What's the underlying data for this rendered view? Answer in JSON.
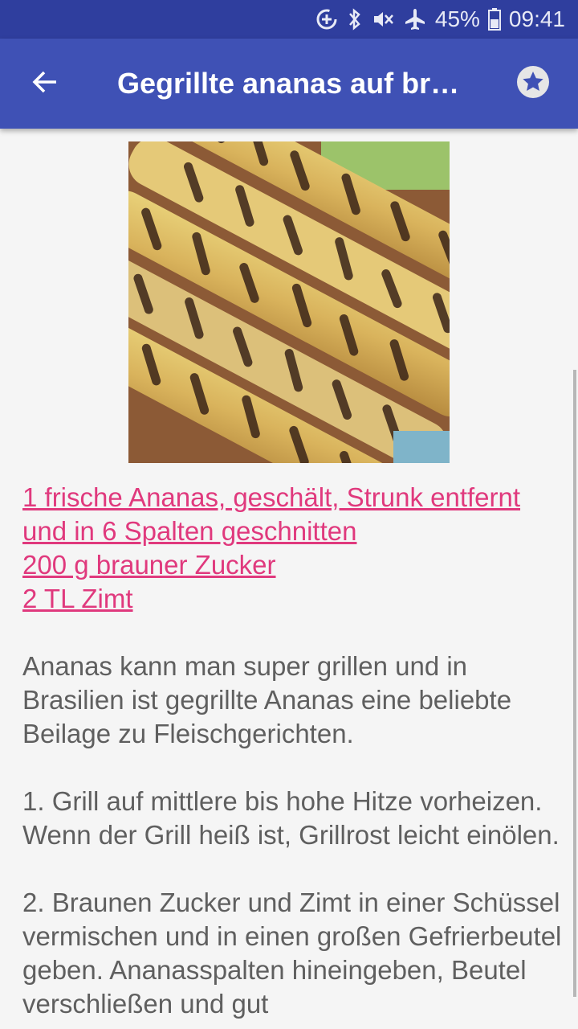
{
  "status_bar": {
    "battery": "45%",
    "time": "09:41",
    "icons": [
      "data-saver-icon",
      "bluetooth-icon",
      "mute-vibrate-icon",
      "airplane-icon",
      "battery-icon"
    ]
  },
  "app_bar": {
    "title": "Gegrillte ananas auf br…",
    "back_icon": "arrow-left-icon",
    "favorite_icon": "star-icon"
  },
  "colors": {
    "status_bar": "#2f3e9e",
    "app_bar": "#3f51b5",
    "link": "#e0397d",
    "body_text": "#5f5f5f",
    "background": "#f5f5f5"
  },
  "recipe": {
    "ingredients": [
      "1 frische Ananas, geschält, Strunk entfernt und in 6 Spalten geschnitten",
      "200 g brauner Zucker",
      "2 TL Zimt"
    ],
    "paragraphs": [
      "Ananas kann man super grillen und in Brasilien ist gegrillte Ananas eine beliebte Beilage zu Fleischgerichten.",
      "1. Grill auf mittlere bis hohe Hitze vorheizen. Wenn der Grill heiß ist, Grillrost leicht einölen.",
      "2. Braunen Zucker und Zimt in einer Schüssel vermischen und in einen großen Gefrierbeutel geben. Ananasspalten hineingeben, Beutel verschließen und gut"
    ]
  }
}
